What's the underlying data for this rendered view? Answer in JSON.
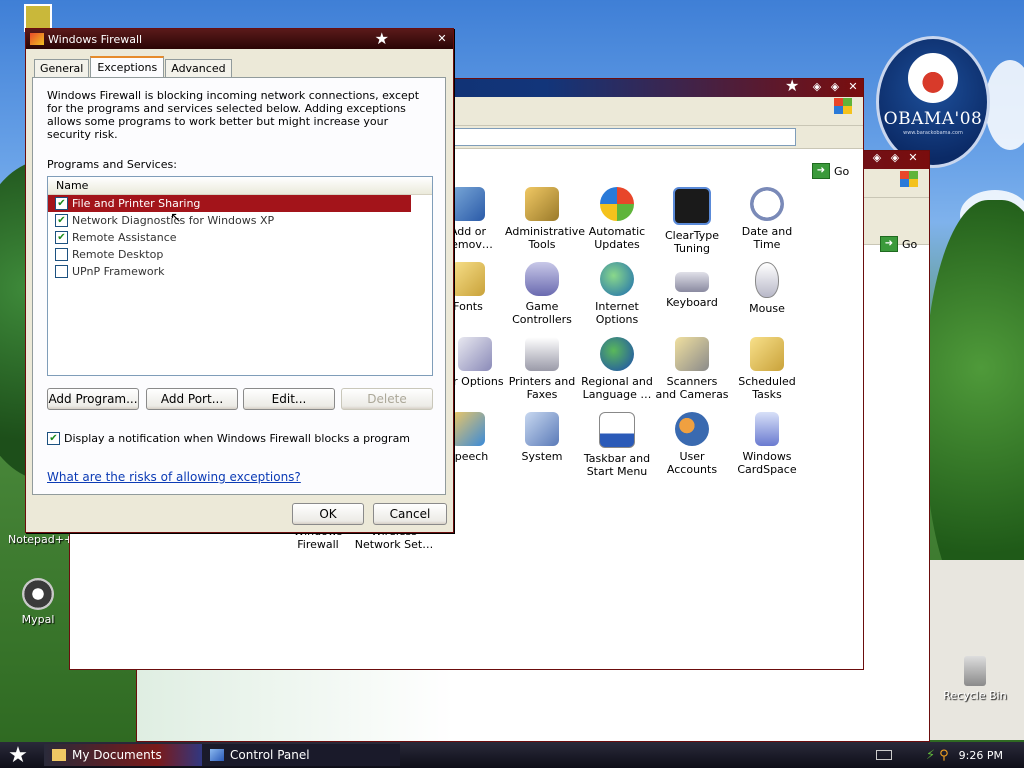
{
  "desktop": {
    "badge_text": "OBAMA'08",
    "badge_small": "www.barackobama.com",
    "icons": [
      {
        "label": "Notepad++"
      },
      {
        "label": "Mypal"
      },
      {
        "label": "Recycle Bin"
      }
    ]
  },
  "cpanel": {
    "go_label": "Go",
    "icons_row1": [
      "Add or Remov…",
      "Administrative Tools",
      "Automatic Updates",
      "ClearType Tuning",
      "Date and Time"
    ],
    "icons_row2": [
      "Fonts",
      "Game Controllers",
      "Internet Options",
      "Keyboard",
      "Mouse"
    ],
    "icons_row3": [
      "er Options",
      "Printers and Faxes",
      "Regional and Language …",
      "Scanners and Cameras",
      "Scheduled Tasks"
    ],
    "icons_row4": [
      "Speech",
      "System",
      "Taskbar and Start Menu",
      "User Accounts",
      "Windows CardSpace"
    ],
    "icons_row5": [
      "Windows Firewall",
      "Wireless Network Set…"
    ]
  },
  "firewall": {
    "title": "Windows Firewall",
    "tabs": [
      "General",
      "Exceptions",
      "Advanced"
    ],
    "description": "Windows Firewall is blocking incoming network connections, except for the programs and services selected below. Adding exceptions allows some programs to work better but might increase your security risk.",
    "list_label": "Programs and Services:",
    "column": "Name",
    "items": [
      {
        "label": "File and Printer Sharing",
        "checked": "✔"
      },
      {
        "label": "Network Diagnostics for Windows XP",
        "checked": "✔"
      },
      {
        "label": "Remote Assistance",
        "checked": "✔"
      },
      {
        "label": "Remote Desktop",
        "checked": ""
      },
      {
        "label": "UPnP Framework",
        "checked": ""
      }
    ],
    "buttons": {
      "add_program": "Add Program...",
      "add_port": "Add Port...",
      "edit": "Edit...",
      "delete": "Delete"
    },
    "notify_check": "✔",
    "notify_label": "Display a notification when Windows Firewall blocks a program",
    "risk_link": "What are the risks of allowing exceptions?",
    "ok": "OK",
    "cancel": "Cancel"
  },
  "taskbar": {
    "items": [
      "My Documents",
      "Control Panel"
    ],
    "clock": "9:26 PM"
  }
}
